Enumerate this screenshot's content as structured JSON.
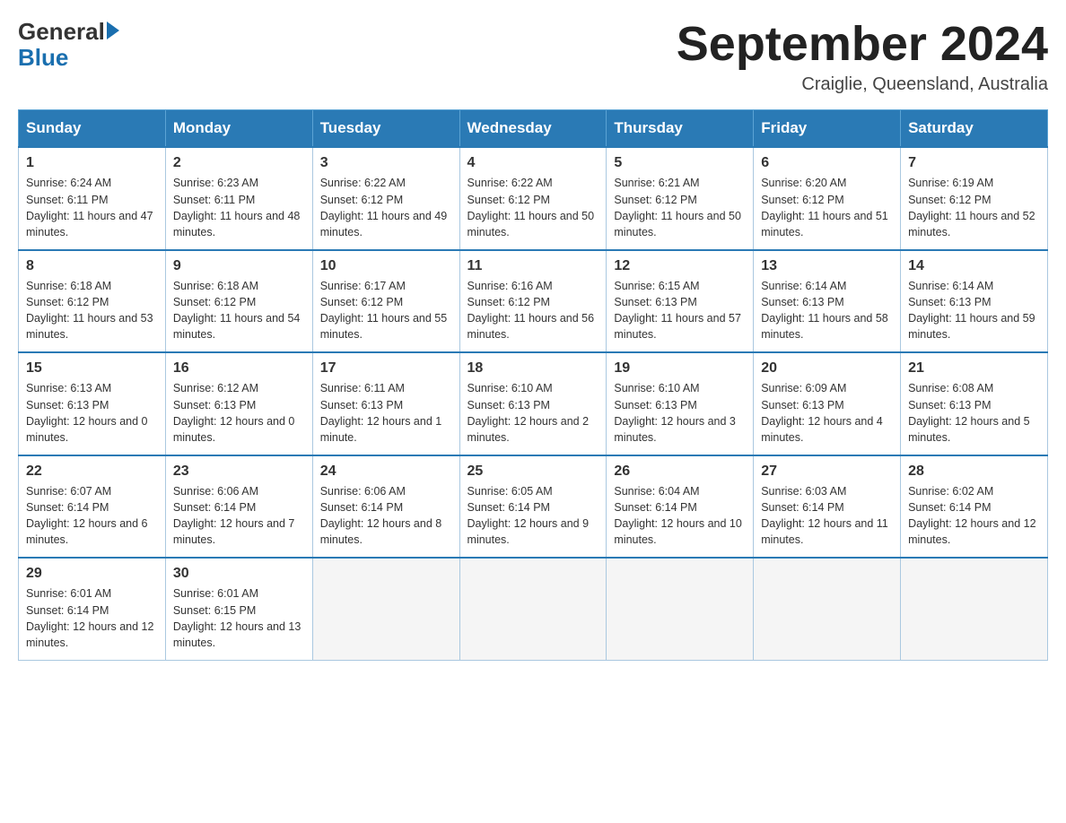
{
  "logo": {
    "general": "General",
    "blue": "Blue",
    "arrow": "▶"
  },
  "title": "September 2024",
  "subtitle": "Craiglie, Queensland, Australia",
  "days_of_week": [
    "Sunday",
    "Monday",
    "Tuesday",
    "Wednesday",
    "Thursday",
    "Friday",
    "Saturday"
  ],
  "weeks": [
    [
      {
        "date": "1",
        "sunrise": "6:24 AM",
        "sunset": "6:11 PM",
        "daylight": "11 hours and 47 minutes."
      },
      {
        "date": "2",
        "sunrise": "6:23 AM",
        "sunset": "6:11 PM",
        "daylight": "11 hours and 48 minutes."
      },
      {
        "date": "3",
        "sunrise": "6:22 AM",
        "sunset": "6:12 PM",
        "daylight": "11 hours and 49 minutes."
      },
      {
        "date": "4",
        "sunrise": "6:22 AM",
        "sunset": "6:12 PM",
        "daylight": "11 hours and 50 minutes."
      },
      {
        "date": "5",
        "sunrise": "6:21 AM",
        "sunset": "6:12 PM",
        "daylight": "11 hours and 50 minutes."
      },
      {
        "date": "6",
        "sunrise": "6:20 AM",
        "sunset": "6:12 PM",
        "daylight": "11 hours and 51 minutes."
      },
      {
        "date": "7",
        "sunrise": "6:19 AM",
        "sunset": "6:12 PM",
        "daylight": "11 hours and 52 minutes."
      }
    ],
    [
      {
        "date": "8",
        "sunrise": "6:18 AM",
        "sunset": "6:12 PM",
        "daylight": "11 hours and 53 minutes."
      },
      {
        "date": "9",
        "sunrise": "6:18 AM",
        "sunset": "6:12 PM",
        "daylight": "11 hours and 54 minutes."
      },
      {
        "date": "10",
        "sunrise": "6:17 AM",
        "sunset": "6:12 PM",
        "daylight": "11 hours and 55 minutes."
      },
      {
        "date": "11",
        "sunrise": "6:16 AM",
        "sunset": "6:12 PM",
        "daylight": "11 hours and 56 minutes."
      },
      {
        "date": "12",
        "sunrise": "6:15 AM",
        "sunset": "6:13 PM",
        "daylight": "11 hours and 57 minutes."
      },
      {
        "date": "13",
        "sunrise": "6:14 AM",
        "sunset": "6:13 PM",
        "daylight": "11 hours and 58 minutes."
      },
      {
        "date": "14",
        "sunrise": "6:14 AM",
        "sunset": "6:13 PM",
        "daylight": "11 hours and 59 minutes."
      }
    ],
    [
      {
        "date": "15",
        "sunrise": "6:13 AM",
        "sunset": "6:13 PM",
        "daylight": "12 hours and 0 minutes."
      },
      {
        "date": "16",
        "sunrise": "6:12 AM",
        "sunset": "6:13 PM",
        "daylight": "12 hours and 0 minutes."
      },
      {
        "date": "17",
        "sunrise": "6:11 AM",
        "sunset": "6:13 PM",
        "daylight": "12 hours and 1 minute."
      },
      {
        "date": "18",
        "sunrise": "6:10 AM",
        "sunset": "6:13 PM",
        "daylight": "12 hours and 2 minutes."
      },
      {
        "date": "19",
        "sunrise": "6:10 AM",
        "sunset": "6:13 PM",
        "daylight": "12 hours and 3 minutes."
      },
      {
        "date": "20",
        "sunrise": "6:09 AM",
        "sunset": "6:13 PM",
        "daylight": "12 hours and 4 minutes."
      },
      {
        "date": "21",
        "sunrise": "6:08 AM",
        "sunset": "6:13 PM",
        "daylight": "12 hours and 5 minutes."
      }
    ],
    [
      {
        "date": "22",
        "sunrise": "6:07 AM",
        "sunset": "6:14 PM",
        "daylight": "12 hours and 6 minutes."
      },
      {
        "date": "23",
        "sunrise": "6:06 AM",
        "sunset": "6:14 PM",
        "daylight": "12 hours and 7 minutes."
      },
      {
        "date": "24",
        "sunrise": "6:06 AM",
        "sunset": "6:14 PM",
        "daylight": "12 hours and 8 minutes."
      },
      {
        "date": "25",
        "sunrise": "6:05 AM",
        "sunset": "6:14 PM",
        "daylight": "12 hours and 9 minutes."
      },
      {
        "date": "26",
        "sunrise": "6:04 AM",
        "sunset": "6:14 PM",
        "daylight": "12 hours and 10 minutes."
      },
      {
        "date": "27",
        "sunrise": "6:03 AM",
        "sunset": "6:14 PM",
        "daylight": "12 hours and 11 minutes."
      },
      {
        "date": "28",
        "sunrise": "6:02 AM",
        "sunset": "6:14 PM",
        "daylight": "12 hours and 12 minutes."
      }
    ],
    [
      {
        "date": "29",
        "sunrise": "6:01 AM",
        "sunset": "6:14 PM",
        "daylight": "12 hours and 12 minutes."
      },
      {
        "date": "30",
        "sunrise": "6:01 AM",
        "sunset": "6:15 PM",
        "daylight": "12 hours and 13 minutes."
      },
      {
        "date": "",
        "sunrise": "",
        "sunset": "",
        "daylight": ""
      },
      {
        "date": "",
        "sunrise": "",
        "sunset": "",
        "daylight": ""
      },
      {
        "date": "",
        "sunrise": "",
        "sunset": "",
        "daylight": ""
      },
      {
        "date": "",
        "sunrise": "",
        "sunset": "",
        "daylight": ""
      },
      {
        "date": "",
        "sunrise": "",
        "sunset": "",
        "daylight": ""
      }
    ]
  ]
}
